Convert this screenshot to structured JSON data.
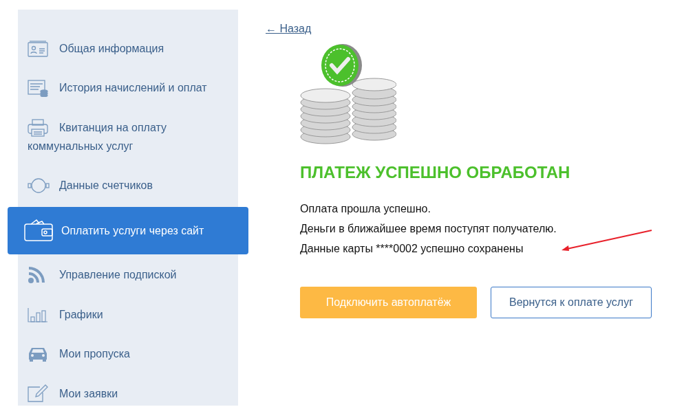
{
  "sidebar": {
    "items": [
      {
        "label": "Общая информация",
        "selected": false
      },
      {
        "label": "История начислений и оплат",
        "selected": false
      },
      {
        "label": "Квитанция на оплату коммунальных услуг",
        "selected": false
      },
      {
        "label": "Данные счетчиков",
        "selected": false
      },
      {
        "label": "Оплатить услуги через сайт",
        "selected": true
      },
      {
        "label": "Управление подпиской",
        "selected": false
      },
      {
        "label": "Графики",
        "selected": false
      },
      {
        "label": "Мои пропуска",
        "selected": false
      },
      {
        "label": "Мои заявки",
        "selected": false
      }
    ]
  },
  "back_link": "← Назад",
  "title": "ПЛАТЕЖ УСПЕШНО ОБРАБОТАН",
  "messages": [
    "Оплата прошла успешно.",
    "Деньги в ближайшее время поступят получателю.",
    "Данные карты ****0002 успешно сохранены"
  ],
  "buttons": [
    {
      "label": "Подключить автоплатёж",
      "kind": "primary"
    },
    {
      "label": "Вернутся к оплате услуг",
      "kind": "outline"
    }
  ]
}
